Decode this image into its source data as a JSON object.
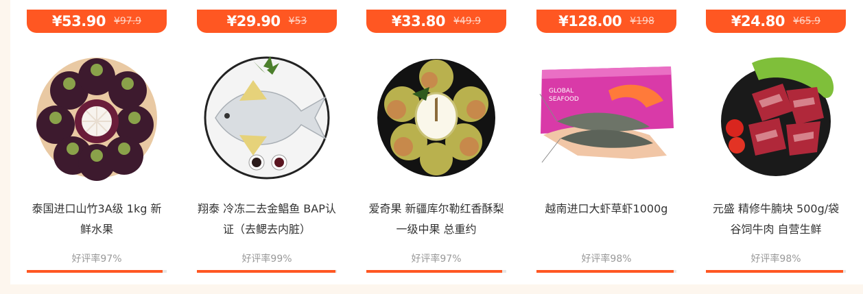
{
  "currency": "¥",
  "accent_color": "#ff5722",
  "products": [
    {
      "price": "¥53.90",
      "original_price": "¥97.9",
      "title": "泰国进口山竹3A级 1kg 新鲜水果",
      "rating_text": "好评率97%",
      "rating_fraction": 0.97,
      "image": "mangosteen-image"
    },
    {
      "price": "¥29.90",
      "original_price": "¥53",
      "title": "翔泰 冷冻二去金鲳鱼 BAP认证（去鳃去内脏）",
      "rating_text": "好评率99%",
      "rating_fraction": 0.99,
      "image": "pomfret-fish-image"
    },
    {
      "price": "¥33.80",
      "original_price": "¥49.9",
      "title": "爱奇果 新疆库尔勒红香酥梨 一级中果 总重约",
      "rating_text": "好评率97%",
      "rating_fraction": 0.97,
      "image": "pear-image"
    },
    {
      "price": "¥128.00",
      "original_price": "¥198",
      "title": "越南进口大虾草虾1000g",
      "rating_text": "好评率98%",
      "rating_fraction": 0.98,
      "image": "shrimp-box-image",
      "box_text": [
        "GLOBAL",
        "SEAFOOD"
      ]
    },
    {
      "price": "¥24.80",
      "original_price": "¥65.9",
      "title": "元盛 精修牛腩块 500g/袋 谷饲牛肉 自营生鲜",
      "rating_text": "好评率98%",
      "rating_fraction": 0.98,
      "image": "beef-image"
    }
  ]
}
